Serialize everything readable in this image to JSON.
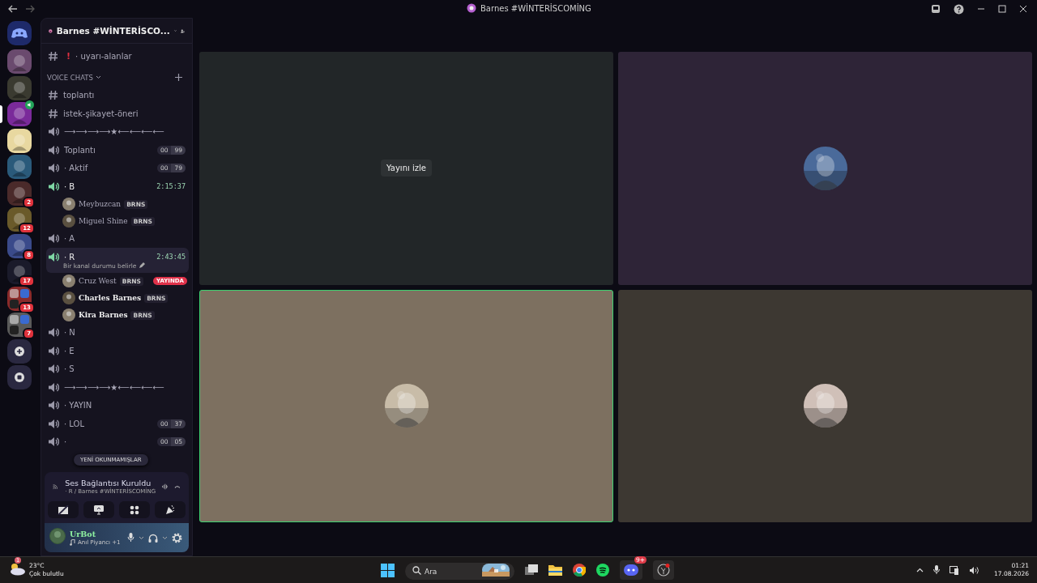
{
  "title_bar": {
    "title": "Barnes #WİNTERİSCOMİNG"
  },
  "servers": [
    {
      "kind": "home",
      "selected": false
    },
    {
      "kind": "server",
      "color": "#6a4a6e",
      "selected": false
    },
    {
      "kind": "server",
      "color": "#3a3a30",
      "selected": false
    },
    {
      "kind": "server",
      "color": "#7a2a9a",
      "selected": true,
      "voice": true
    },
    {
      "kind": "server",
      "color": "#e8d8a0",
      "selected": false
    },
    {
      "kind": "server",
      "color": "#2a5a7a",
      "selected": false
    },
    {
      "kind": "server",
      "color": "#4a2a2a",
      "selected": false,
      "mentions": "2"
    },
    {
      "kind": "server",
      "color": "#6a5a2a",
      "selected": false,
      "mentions": "12"
    },
    {
      "kind": "server",
      "color": "#3a4a8a",
      "selected": false,
      "mentions": "8"
    },
    {
      "kind": "server",
      "color": "#1a1a2a",
      "selected": false,
      "mentions": "17"
    },
    {
      "kind": "folder",
      "color": "#8a2a2a",
      "selected": false,
      "mentions": "13"
    },
    {
      "kind": "folder",
      "color": "#5a5a5a",
      "selected": false,
      "mentions": "7"
    },
    {
      "kind": "add"
    },
    {
      "kind": "discover"
    }
  ],
  "sidebar": {
    "server_name": "Barnes #WİNTERİSCO...",
    "top_channels": [
      {
        "kind": "text",
        "alert": "!",
        "name": "· uyarı-alanlar"
      }
    ],
    "category": {
      "name": "VOICE CHATS",
      "expanded": true
    },
    "channels": [
      {
        "kind": "text",
        "name": "toplantı"
      },
      {
        "kind": "text",
        "name": "istek-şikayet-öneri"
      },
      {
        "kind": "voice",
        "name": "⟶⟶⟶⟶★⟵⟵⟵⟵",
        "active": false,
        "selected": false
      },
      {
        "kind": "voice",
        "name": "Toplantı",
        "active": false,
        "selected": false,
        "limit": [
          "00",
          "99"
        ]
      },
      {
        "kind": "voice",
        "name": "· Aktif",
        "active": false,
        "selected": false,
        "limit": [
          "00",
          "79"
        ]
      },
      {
        "kind": "voice",
        "name": "· B",
        "active": true,
        "selected": false,
        "timer": "2:15:37",
        "users": [
          {
            "name": "Meybuzcan",
            "tag": "BRNS",
            "bold": false
          },
          {
            "name": "Miguel Shine",
            "tag": "BRNS",
            "bold": false
          }
        ]
      },
      {
        "kind": "voice",
        "name": "· A",
        "active": false,
        "selected": false
      },
      {
        "kind": "voice",
        "name": "· R",
        "active": true,
        "selected": true,
        "timer": "2:43:45",
        "status": "Bir kanal durumu belirle",
        "users": [
          {
            "name": "Cruz West",
            "tag": "BRNS",
            "bold": false,
            "live": "YAYINDA"
          },
          {
            "name": "Charles Barnes",
            "tag": "BRNS",
            "bold": true
          },
          {
            "name": "Kira Barnes",
            "tag": "BRNS",
            "bold": true
          }
        ]
      },
      {
        "kind": "voice",
        "name": "· N",
        "active": false,
        "selected": false
      },
      {
        "kind": "voice",
        "name": "· E",
        "active": false,
        "selected": false
      },
      {
        "kind": "voice",
        "name": "· S",
        "active": false,
        "selected": false
      },
      {
        "kind": "voice",
        "name": "⟶⟶⟶⟶★⟵⟵⟵⟵",
        "active": false,
        "selected": false
      },
      {
        "kind": "voice",
        "name": "· YAYIN",
        "active": false,
        "selected": false
      },
      {
        "kind": "voice",
        "name": "· LOL",
        "active": false,
        "selected": false,
        "limit": [
          "00",
          "37"
        ]
      },
      {
        "kind": "voice",
        "name": "·",
        "active": false,
        "selected": false,
        "limit": [
          "00",
          "05"
        ]
      }
    ],
    "unread_pill": "YENİ OKUNMAMIŞLAR"
  },
  "voice_panel": {
    "status": "Ses Bağlantısı Kuruldu",
    "location": "· R / Barnes #WİNTERİSCOMİNG"
  },
  "user_panel": {
    "name": "UrBot",
    "activity": "Anıl Piyancı +1"
  },
  "tiles": [
    {
      "kind": "stream",
      "color": "#222628",
      "speaking": false,
      "watch_button": "Yayını izle"
    },
    {
      "kind": "picture",
      "color": "#2e2437",
      "speaking": false
    },
    {
      "kind": "picture",
      "color": "#7d7060",
      "speaking": true
    },
    {
      "kind": "picture",
      "color": "#3d3832",
      "speaking": false
    }
  ],
  "taskbar": {
    "weather_temp": "23°C",
    "weather_text": "Çok bulutlu",
    "weather_badge": "1",
    "search_placeholder": "Ara",
    "discord_badge": "9+",
    "time": "01:21",
    "date": "17.08.2026"
  }
}
